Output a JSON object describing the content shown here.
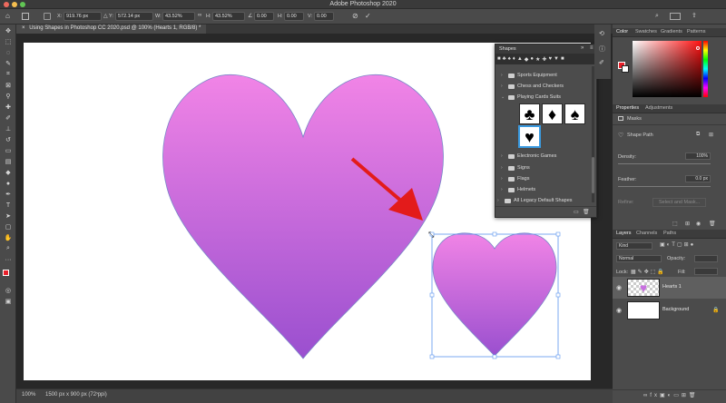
{
  "app_title": "Adobe Photoshop 2020",
  "options_bar": {
    "x_label": "X:",
    "x_value": "919.76 px",
    "y_label": "Y:",
    "y_value": "572.14 px",
    "w_label": "W:",
    "w_value": "43.52%",
    "h_label": "H:",
    "h_value": "43.52%",
    "angle_value": "0.00",
    "hskew_label": "H:",
    "hskew_value": "0.00",
    "vskew_label": "V:",
    "vskew_value": "0.00"
  },
  "document_tab": "Using Shapes in Photoshop CC 2020.psd @ 100% (Hearts 1, RGB/8) *",
  "status": {
    "zoom": "100%",
    "doc_size": "1500 px x 900 px (72 ppi)"
  },
  "shapes_panel": {
    "title": "Shapes",
    "items": [
      {
        "label": "Sports Equipment",
        "expanded": false
      },
      {
        "label": "Chess and Checkers",
        "expanded": false
      },
      {
        "label": "Playing Cards Suits",
        "expanded": true
      },
      {
        "label": "Electronic Games",
        "expanded": false
      },
      {
        "label": "Signs",
        "expanded": false
      },
      {
        "label": "Flags",
        "expanded": false
      },
      {
        "label": "Helmets",
        "expanded": false
      },
      {
        "label": "All Legacy Default Shapes",
        "expanded": false
      }
    ],
    "suits": [
      "club-icon",
      "diamond-icon",
      "spade-icon",
      "heart-icon"
    ],
    "selected_suit": "heart-icon"
  },
  "color_panel": {
    "tabs": [
      "Color",
      "Swatches",
      "Gradients",
      "Patterns"
    ],
    "foreground": "#e8202a",
    "background": "#ffffff"
  },
  "properties_panel": {
    "tabs": [
      "Properties",
      "Adjustments"
    ],
    "masks_label": "Masks",
    "shape_path_label": "Shape Path",
    "density_label": "Density:",
    "density_value": "100%",
    "feather_label": "Feather:",
    "feather_value": "0.0 px",
    "refine_label": "Refine:",
    "select_mask_label": "Select and Mask..."
  },
  "layers_panel": {
    "tabs": [
      "Layers",
      "Channels",
      "Paths"
    ],
    "kind_label": "Kind",
    "blend_mode": "Normal",
    "opacity_label": "Opacity:",
    "lock_label": "Lock:",
    "fill_label": "Fill:",
    "layers": [
      {
        "name": "Hearts 1",
        "selected": true
      },
      {
        "name": "Background",
        "selected": false
      }
    ]
  },
  "colors": {
    "heart_top": "#f184e6",
    "heart_bottom": "#9a4fcf",
    "arrow": "#e31b1b",
    "selection": "#5b95ee"
  }
}
